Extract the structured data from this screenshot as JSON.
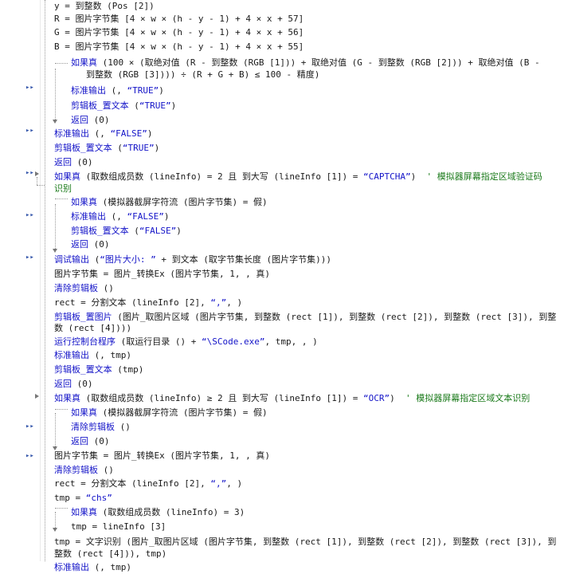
{
  "lines": [
    {
      "t": "y = 到整数 (Pos [2])"
    },
    {
      "t": "R = 图片字节集 [4 × w × (h - y - 1) + 4 × x + 57]"
    },
    {
      "t": "G = 图片字节集 [4 × w × (h - y - 1) + 4 × x + 56]"
    },
    {
      "t": "B = 图片字节集 [4 × w × (h - y - 1) + 4 × x + 55]"
    },
    {
      "kw": "如果真",
      "t": " (100 × (取绝对值 (R - 到整数 (RGB [1])) + 取绝对值 (G - 到整数 (RGB [2])) + 取绝对值 (B -"
    },
    {
      "t": "到整数 (RGB [3]))) ÷ (R + G + B) ≤ 100 - 精度)"
    },
    {
      "kw": "标准输出",
      "t": " (, ",
      "s": "“TRUE”",
      "e": ")"
    },
    {
      "kw": "剪辑板_置文本",
      "t": " (",
      "s": "“TRUE”",
      "e": ")"
    },
    {
      "kw": "返回",
      "t": " (0)"
    },
    {
      "kw": "标准输出",
      "t": " (, ",
      "s": "“FALSE”",
      "e": ")"
    },
    {
      "kw": "剪辑板_置文本",
      "t": " (",
      "s": "“TRUE”",
      "e": ")"
    },
    {
      "kw": "返回",
      "t": " (0)"
    },
    {
      "kw": "如果真",
      "t": " (取数组成员数 (lineInfo) = 2 且 到大写 (lineInfo [1]) = ",
      "s": "“CAPTCHA”",
      "e": ")  ",
      "c": "' 模拟器屏幕指定区域验证码"
    },
    {
      "c": "识别"
    },
    {
      "kw": "如果真",
      "t": " (模拟器截屏字符流 (图片字节集) = 假)"
    },
    {
      "kw": "标准输出",
      "t": " (, ",
      "s": "“FALSE”",
      "e": ")"
    },
    {
      "kw": "剪辑板_置文本",
      "t": " (",
      "s": "“FALSE”",
      "e": ")"
    },
    {
      "kw": "返回",
      "t": " (0)"
    },
    {
      "kw": "调试输出",
      "t": " (",
      "s": "“图片大小: ”",
      "e": " + 到文本 (取字节集长度 (图片字节集)))"
    },
    {
      "t": "图片字节集 = 图片_转换Ex (图片字节集, 1, , 真)"
    },
    {
      "kw": "清除剪辑板",
      "t": " ()"
    },
    {
      "t": "rect = 分割文本 (lineInfo [2], ",
      "s": "“,”",
      "e": ", )"
    },
    {
      "kw": "剪辑板_置图片",
      "t": " (图片_取图片区域 (图片字节集, 到整数 (rect [1]), 到整数 (rect [2]), 到整数 (rect [3]), 到整"
    },
    {
      "t": "数 (rect [4])))"
    },
    {
      "kw": "运行控制台程序",
      "t": " (取运行目录 () + ",
      "s": "“\\SCode.exe”",
      "e": ", tmp, , )"
    },
    {
      "kw": "标准输出",
      "t": " (, tmp)"
    },
    {
      "kw": "剪辑板_置文本",
      "t": " (tmp)"
    },
    {
      "kw": "返回",
      "t": " (0)"
    },
    {
      "kw": "如果真",
      "t": " (取数组成员数 (lineInfo) ≥ 2 且 到大写 (lineInfo [1]) = ",
      "s": "“OCR”",
      "e": ")  ",
      "c": "' 模拟器屏幕指定区域文本识别"
    },
    {
      "kw": "如果真",
      "t": " (模拟器截屏字符流 (图片字节集) = 假)"
    },
    {
      "kw": "清除剪辑板",
      "t": " ()"
    },
    {
      "kw": "返回",
      "t": " (0)"
    },
    {
      "t": "图片字节集 = 图片_转换Ex (图片字节集, 1, , 真)"
    },
    {
      "kw": "清除剪辑板",
      "t": " ()"
    },
    {
      "t": "rect = 分割文本 (lineInfo [2], ",
      "s": "“,”",
      "e": ", )"
    },
    {
      "t": "tmp = ",
      "s": "“chs”"
    },
    {
      "kw": "如果真",
      "t": " (取数组成员数 (lineInfo) = 3)"
    },
    {
      "t": "tmp = lineInfo [3]"
    },
    {
      "t": "tmp = 文字识别 (图片_取图片区域 (图片字节集, 到整数 (rect [1]), 到整数 (rect [2]), 到整数 (rect [3]), 到"
    },
    {
      "t": "整数 (rect [4])), tmp)"
    },
    {
      "kw": "标准输出",
      "t": " (, tmp)"
    }
  ]
}
